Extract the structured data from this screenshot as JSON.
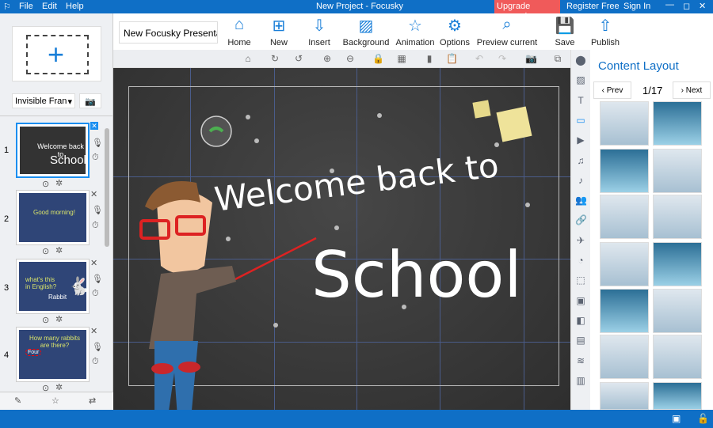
{
  "titlebar": {
    "menu": [
      "File",
      "Edit",
      "Help"
    ],
    "title": "New Project - Focusky",
    "upgrade": "Upgrade account",
    "register": "Register Free",
    "signin": "Sign In"
  },
  "toolbar": {
    "project_name": "New Focusky Presenta",
    "buttons": [
      {
        "label": "Home",
        "icon": "home-icon"
      },
      {
        "label": "New",
        "icon": "new-icon"
      },
      {
        "label": "Insert",
        "icon": "insert-icon"
      },
      {
        "label": "Background",
        "icon": "background-icon"
      },
      {
        "label": "Animation",
        "icon": "animation-icon"
      },
      {
        "label": "Options",
        "icon": "gear-icon"
      },
      {
        "label": "Preview current",
        "icon": "preview-icon"
      },
      {
        "label": "Save",
        "icon": "save-icon"
      },
      {
        "label": "Publish",
        "icon": "publish-icon"
      }
    ]
  },
  "leftpanel": {
    "frame_type": "Invisible Fran",
    "slides": [
      {
        "num": "1",
        "title": "Welcome back to",
        "subtitle": "School"
      },
      {
        "num": "2",
        "title": "Good morning!"
      },
      {
        "num": "3",
        "title": "what's this in English?",
        "subtitle": "Rabbit"
      },
      {
        "num": "4",
        "title": "How many rabbits are there?",
        "subtitle": "Four"
      }
    ]
  },
  "canvas": {
    "line1": "Welcome back to",
    "line2": "School"
  },
  "content": {
    "title": "Content Layout",
    "prev": "Prev",
    "next": "Next",
    "page": "1/17",
    "accent": "#0f6fc6"
  }
}
